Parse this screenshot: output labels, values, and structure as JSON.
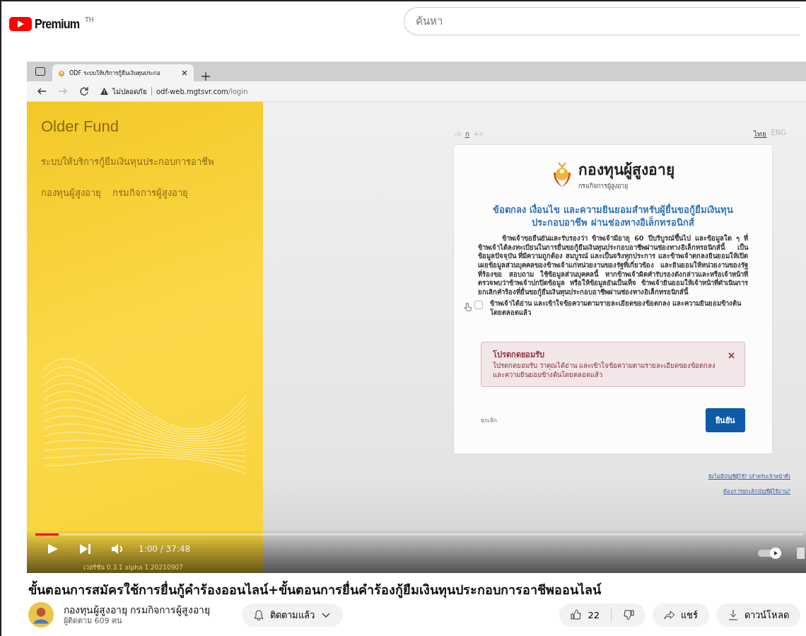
{
  "header": {
    "logo": "Premium",
    "region": "TH",
    "search": {
      "placeholder": "ค้นหา"
    }
  },
  "video": {
    "browser": {
      "tab": {
        "title": "ODF ระบบให้บริการกู้ยืมเงินทุนประกอ"
      },
      "address": {
        "warning": "ไม่ปลอดภัย",
        "host": "odf-web.mgtsvr.com",
        "path": "/login"
      }
    },
    "site": {
      "brand": "Older Fund",
      "subtitle": "ระบบให้บริการกู้ยืมเงินทุนประกอบการอาชีพ",
      "orgs": [
        "กองทุนผู้สูงอายุ",
        "กรมกิจการผู้สูงอายุ"
      ],
      "font_sizes": [
        {
          "label": "-ก",
          "selected": false
        },
        {
          "label": "ก",
          "selected": true
        },
        {
          "label": "+ก",
          "selected": false
        }
      ],
      "languages": [
        {
          "label": "ไทย",
          "selected": true
        },
        {
          "label": "ENG",
          "selected": false
        }
      ],
      "card": {
        "logo_title": "กองทุนผู้สูงอายุ",
        "logo_subtitle": "กรมกิจการผู้สูงอายุ",
        "heading": "ข้อตกลง เงื่อนไข และความยินยอมสำหรับผู้ยื่นขอกู้ยืมเงินทุนประกอบอาชีพ ผ่านช่องทางอิเล็กทรอนิกส์",
        "body": "ข้าพเจ้าขอยืนยันและรับรองว่า ข้าพเจ้ามีอายุ 60 ปีบริบูรณ์ขึ้นไป และข้อมูลใด ๆ ที่ข้าพเจ้าได้ลงทะเบียนในการยื่นขอกู้ยืมเงินทุนประกอบอาชีพผ่านช่องทางอิเล็กทรอนิกส์นี้ เป็นข้อมูลปัจจุบัน ที่มีความถูกต้อง สมบูรณ์ และเป็นจริงทุกประการ และข้าพเจ้าตกลงยินยอมให้เปิดเผยข้อมูลส่วนบุคคลของข้าพเจ้าแก่หน่วยงานของรัฐที่เกี่ยวข้อง และยินยอมให้หน่วยงานของรัฐที่ร้องขอ สอบถาม ใช้ข้อมูลส่วนบุคคลนี้ หากข้าพเจ้าผิดคำรับรองดังกล่าวและหรือเจ้าหน้าที่ตรวจพบว่าข้าพเจ้าปกปิดข้อมูล หรือให้ข้อมูลอันเป็นเท็จ ข้าพเจ้ายินยอมให้เจ้าหน้าที่ดำเนินการยกเลิกคำร้องที่ยื่นขอกู้ยืมเงินทุนประกอบอาชีพผ่านช่องทางอิเล็กทรอนิกส์นี้",
        "consent": {
          "label": "ข้าพเจ้าได้อ่าน และเข้าใจข้อความตามรายละเอียดของข้อตกลง และความยินยอมข้างต้นโดยตลอดแล้ว",
          "checked": false
        },
        "alert": {
          "title": "โปรดกดยอมรับ",
          "message": "โปรดกดยอมรับ ว่าคุณได้อ่าน และเข้าใจข้อความตามรายละเอียดของข้อตกลง และความยินยอมข้างต้นโดยตลอดแล้ว"
        },
        "cancel": "ยกเลิก",
        "confirm": "ยืนยัน"
      },
      "links": [
        "ยังไม่มีบัญชีผู้ใช้? (สำหรับเจ้าหน้าที่)",
        "ต้องการยกเลิกบัญชีผู้ใช้งาน?"
      ],
      "version": "เวอร์ชั่น 0.3.1 alpha 1.20210907"
    },
    "player": {
      "level": 0.03,
      "time": "1:00 / 37:48",
      "autoplay": {
        "on": true
      }
    }
  },
  "title": "ขั้นตอนการสมัครใช้การยื่นกู้คำร้องออนไลน์+ขั้นตอนการยื่นคำร้องกู้ยืมเงินทุนประกอบการอาชีพออนไลน์",
  "channel": {
    "name": "กองทุนผู้สูงอายุ กรมกิจการผู้สูงอายุ",
    "subscribers": "ผู้ติดตาม 609 คน",
    "subscribe": "ติดตามแล้ว"
  },
  "actions": {
    "likes": "22",
    "share": "แชร์",
    "download": "ดาวน์โหลด"
  }
}
